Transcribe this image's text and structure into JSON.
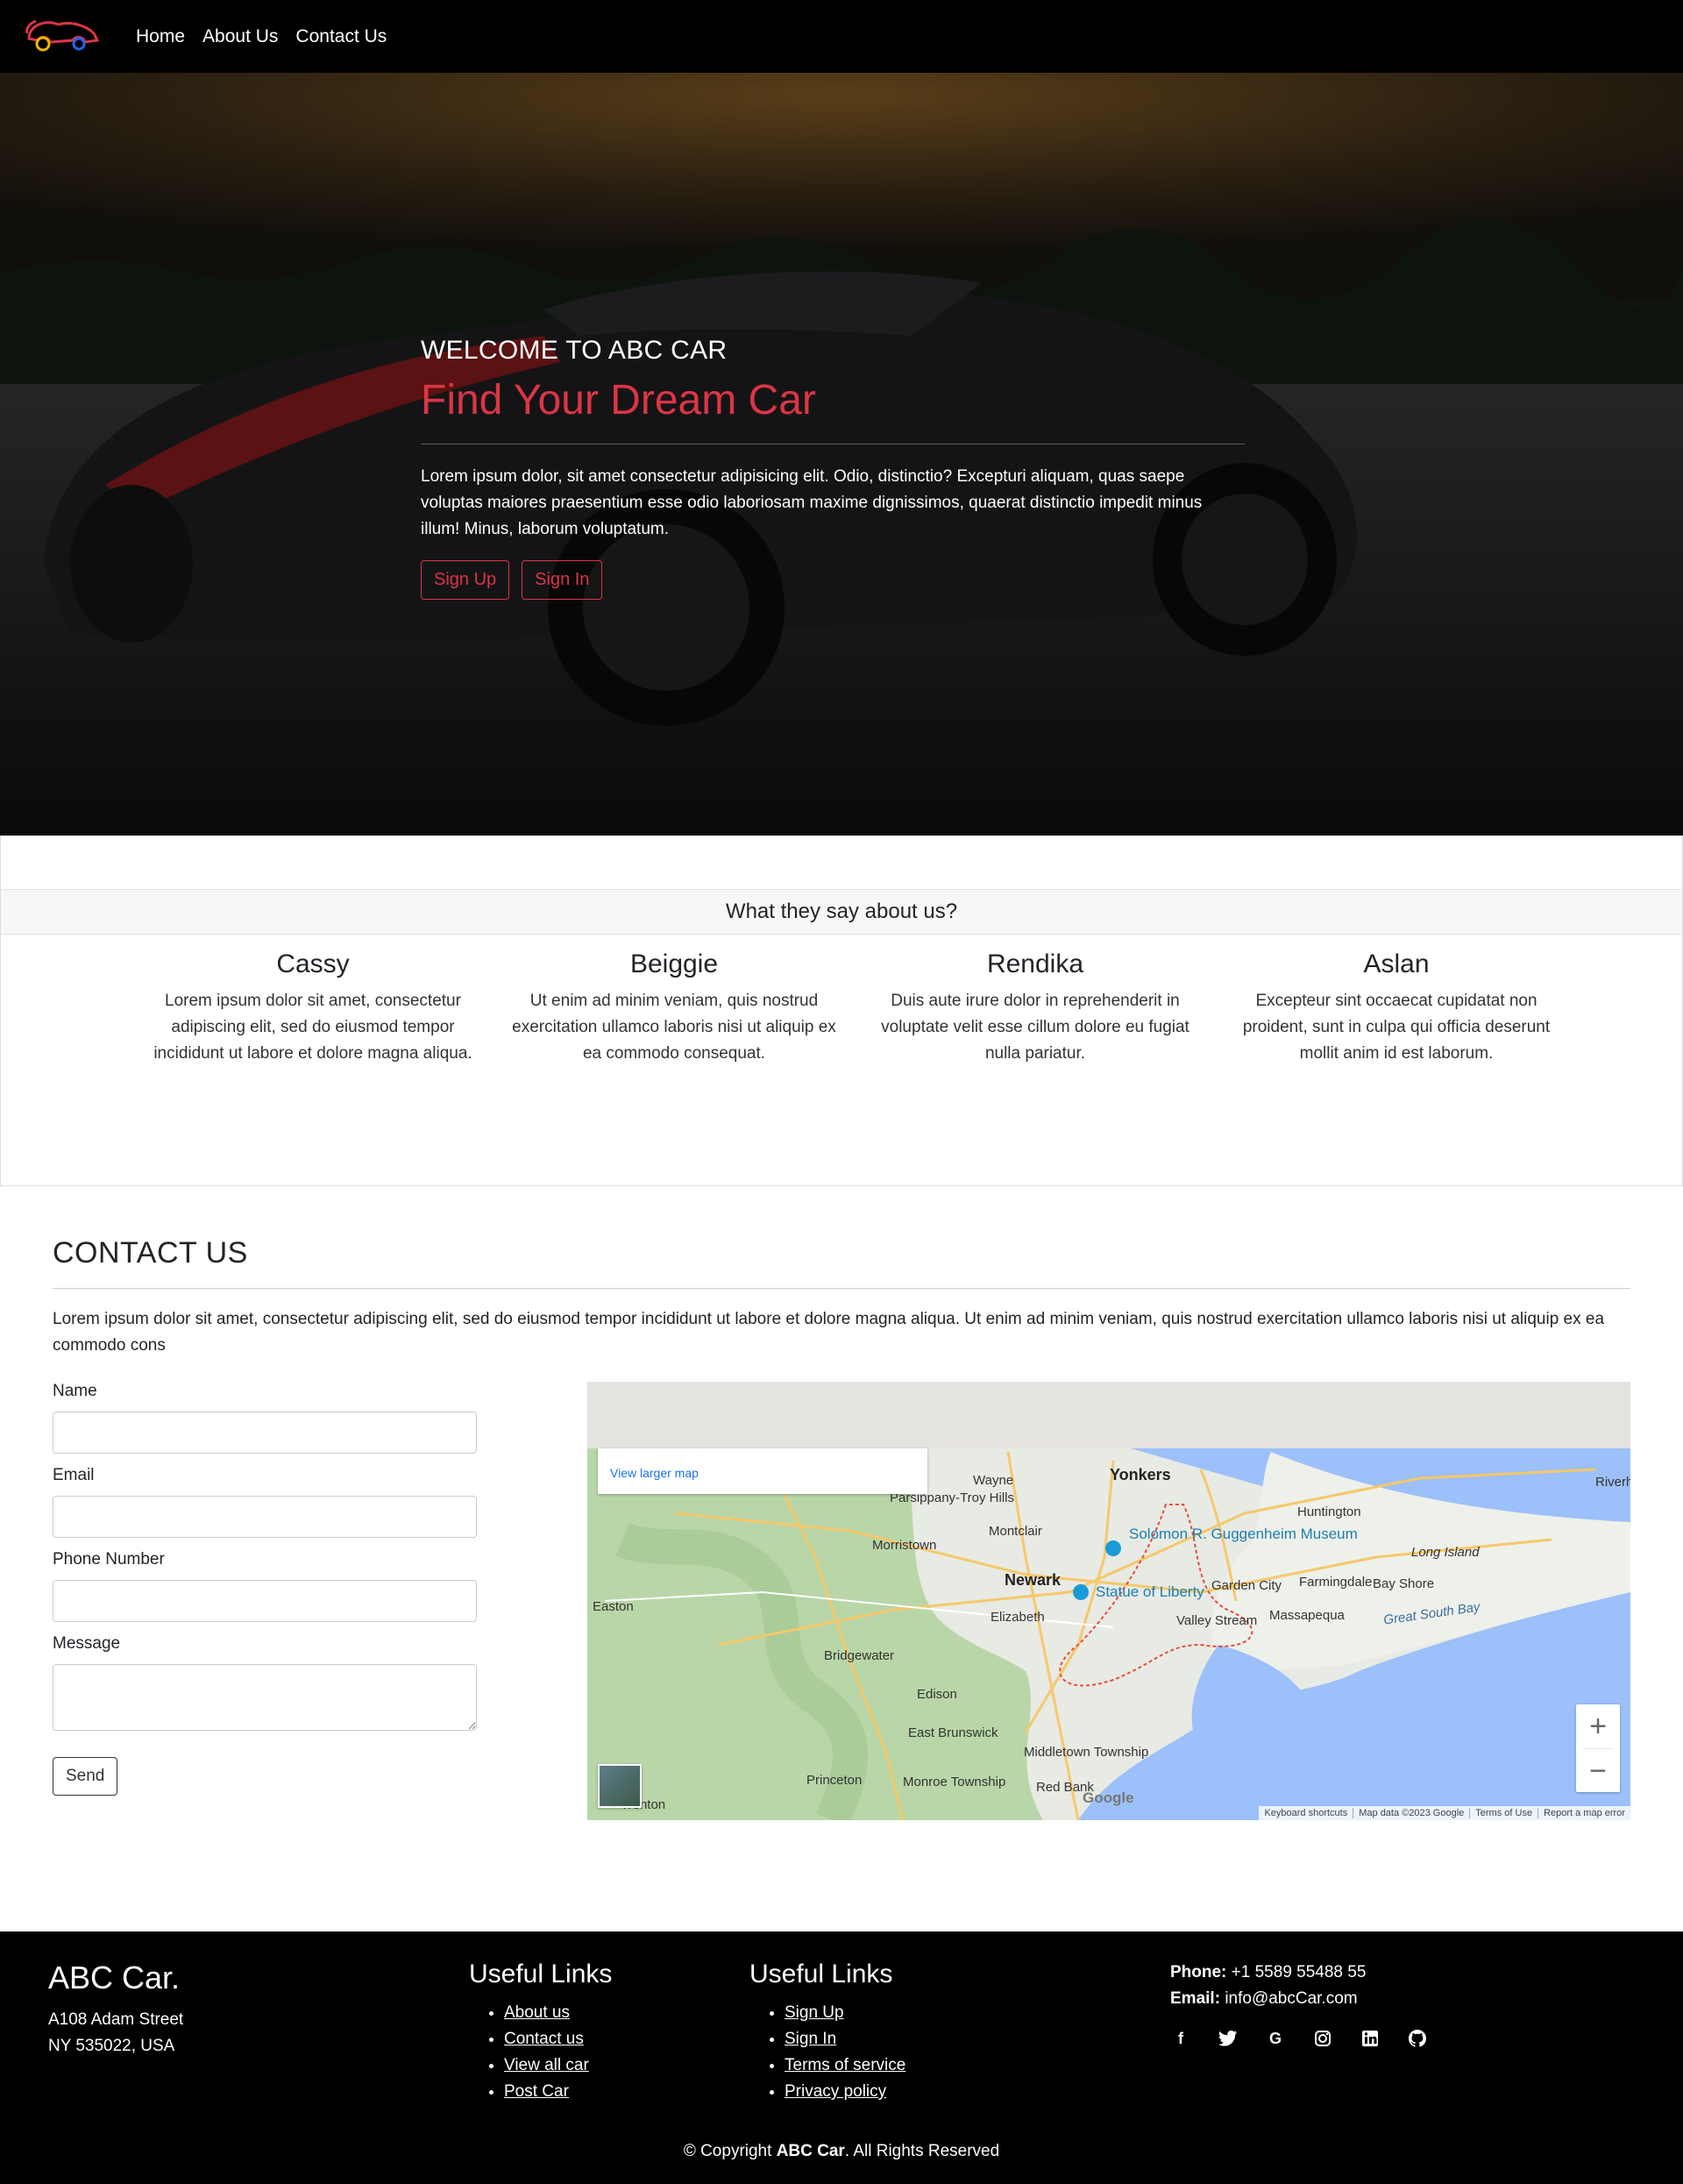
{
  "nav": {
    "links": [
      "Home",
      "About Us",
      "Contact Us"
    ]
  },
  "hero": {
    "welcome": "WELCOME TO ABC CAR",
    "title": "Find Your Dream Car",
    "text": "Lorem ipsum dolor, sit amet consectetur adipisicing elit. Odio, distinctio? Excepturi aliquam, quas saepe voluptas maiores praesentium esse odio laboriosam maxime dignissimos, quaerat distinctio impedit minus illum! Minus, laborum voluptatum.",
    "signup": "Sign Up",
    "signin": "Sign In"
  },
  "testimonials": {
    "heading": "What they say about us?",
    "items": [
      {
        "name": "Cassy",
        "text": "Lorem ipsum dolor sit amet, consectetur adipiscing elit, sed do eiusmod tempor incididunt ut labore et dolore magna aliqua."
      },
      {
        "name": "Beiggie",
        "text": "Ut enim ad minim veniam, quis nostrud exercitation ullamco laboris nisi ut aliquip ex ea commodo consequat."
      },
      {
        "name": "Rendika",
        "text": "Duis aute irure dolor in reprehenderit in voluptate velit esse cillum dolore eu fugiat nulla pariatur."
      },
      {
        "name": "Aslan",
        "text": "Excepteur sint occaecat cupidatat non proident, sunt in culpa qui officia deserunt mollit anim id est laborum."
      }
    ]
  },
  "contact": {
    "title": "CONTACT US",
    "description": "Lorem ipsum dolor sit amet, consectetur adipiscing elit, sed do eiusmod tempor incididunt ut labore et dolore magna aliqua. Ut enim ad minim veniam, quis nostrud exercitation ullamco laboris nisi ut aliquip ex ea commodo cons",
    "name_label": "Name",
    "email_label": "Email",
    "phone_label": "Phone Number",
    "message_label": "Message",
    "send": "Send"
  },
  "map": {
    "view_larger": "View larger map",
    "zoom_in": "+",
    "zoom_out": "−",
    "google": "Google",
    "footer": [
      "Keyboard shortcuts",
      "Map data ©2023 Google",
      "Terms of Use",
      "Report a map error"
    ],
    "labels": [
      "Yonkers",
      "Wayne",
      "Parsippany-Troy Hills",
      "Morristown",
      "Montclair",
      "Newark",
      "Solomon R. Guggenheim Museum",
      "Statue of Liberty",
      "Huntington",
      "Long Island",
      "Garden City",
      "Farmingdale",
      "Bay Shore",
      "Massapequa",
      "Valley Stream",
      "Great South Bay",
      "Elizabeth",
      "Easton",
      "Bridgewater",
      "Edison",
      "East Brunswick",
      "Middletown Township",
      "Red Bank",
      "Princeton",
      "Monroe Township",
      "Riverhead",
      "Trenton"
    ]
  },
  "footer": {
    "brand": "ABC Car.",
    "address1": "A108 Adam Street",
    "address2": "NY 535022, USA",
    "col1_title": "Useful Links",
    "col1_links": [
      "About us",
      "Contact us",
      "View all car",
      "Post Car"
    ],
    "col2_title": "Useful Links",
    "col2_links": [
      "Sign Up",
      "Sign In",
      "Terms of service",
      "Privacy policy"
    ],
    "phone_label": "Phone:",
    "phone": "+1 5589 55488 55",
    "email_label": "Email:",
    "email": "info@abcCar.com",
    "copyright_pre": "© Copyright",
    "copyright_brand": "ABC Car",
    "copyright_post": ". All Rights Reserved"
  },
  "colors": {
    "accent": "#dc3545",
    "navbar": "#000000",
    "footer": "#000000"
  },
  "icons": {
    "social": [
      "facebook-icon",
      "twitter-icon",
      "google-icon",
      "instagram-icon",
      "linkedin-icon",
      "github-icon"
    ]
  }
}
